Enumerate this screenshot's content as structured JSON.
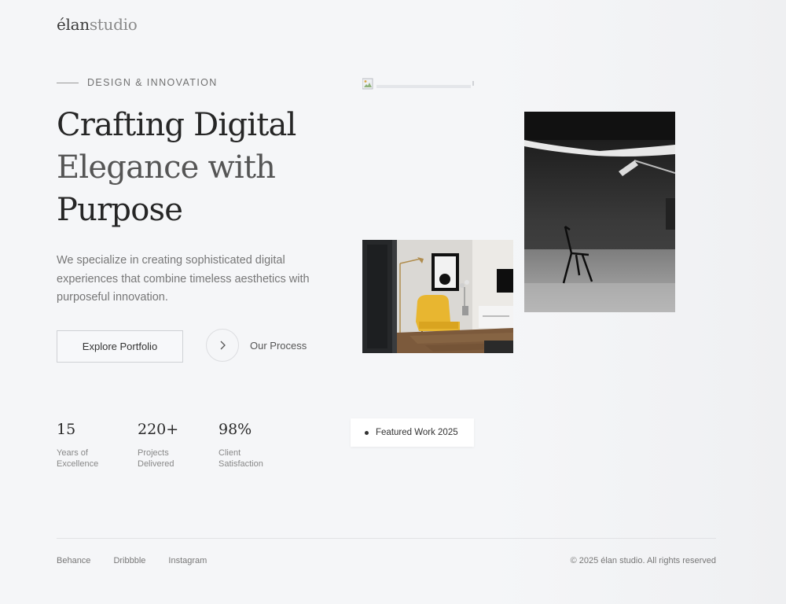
{
  "brand": {
    "logo_bold": "élan",
    "logo_light": "studio"
  },
  "hero": {
    "eyebrow": "DESIGN & INNOVATION",
    "headline_line1": "Crafting Digital",
    "headline_line2": "Elegance with",
    "headline_line3": "Purpose",
    "lead": "We specialize in creating sophisticated digital experiences that combine timeless aesthetics with purposeful innovation.",
    "primary_button": "Explore Portfolio",
    "secondary_link": "Our Process"
  },
  "stats": [
    {
      "value": "15",
      "label": "Years of Excellence"
    },
    {
      "value": "220+",
      "label": "Projects Delivered"
    },
    {
      "value": "98%",
      "label": "Client Satisfaction"
    }
  ],
  "featured_badge": "Featured Work 2025",
  "footer": {
    "links": [
      "Behance",
      "Dribbble",
      "Instagram"
    ],
    "copyright": "© 2025 élan studio. All rights reserved"
  },
  "colors": {
    "background": "#f5f6f8",
    "text": "#262626",
    "muted": "#777777",
    "accent_chair": "#e8b630"
  },
  "icons": {
    "process_arrow": "chevron-right-icon",
    "broken_image": "broken-image-icon"
  }
}
